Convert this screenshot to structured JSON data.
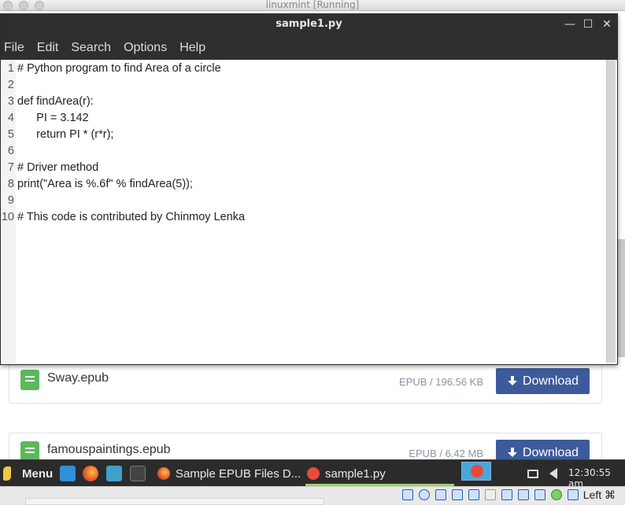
{
  "host": {
    "title": "linuxmint [Running]",
    "host_key": "Left ⌘"
  },
  "browser": {
    "files": [
      {
        "name": "Sway.epub",
        "meta": "EPUB / 196.56 KB",
        "button": "Download"
      },
      {
        "name": "famouspaintings.epub",
        "meta": "EPUB / 6.42 MB",
        "button": "Download"
      }
    ]
  },
  "editor": {
    "title": "sample1.py",
    "controls": {
      "minimize": "—",
      "maximize": "☐",
      "close": "✕"
    },
    "menu": [
      "File",
      "Edit",
      "Search",
      "Options",
      "Help"
    ],
    "lines": [
      {
        "n": "1",
        "text": "# Python program to find Area of a circle"
      },
      {
        "n": "2",
        "text": ""
      },
      {
        "n": "3",
        "text": "def findArea(r):"
      },
      {
        "n": "4",
        "text": "      PI = 3.142"
      },
      {
        "n": "5",
        "text": "      return PI * (r*r);"
      },
      {
        "n": "6",
        "text": ""
      },
      {
        "n": "7",
        "text": "# Driver method"
      },
      {
        "n": "8",
        "text": "print(\"Area is %.6f\" % findArea(5));"
      },
      {
        "n": "9",
        "text": ""
      },
      {
        "n": "10",
        "text": "# This code is contributed by Chinmoy Lenka"
      }
    ]
  },
  "taskbar": {
    "menu_label": "Menu",
    "windows": [
      {
        "label": "Sample EPUB Files D..."
      },
      {
        "label": "sample1.py"
      }
    ],
    "clock": "12:30:55 am"
  },
  "colors": {
    "download_button": "#3d5a9a",
    "epub_icon": "#5cb85c",
    "active_window": "#9ad26d"
  }
}
